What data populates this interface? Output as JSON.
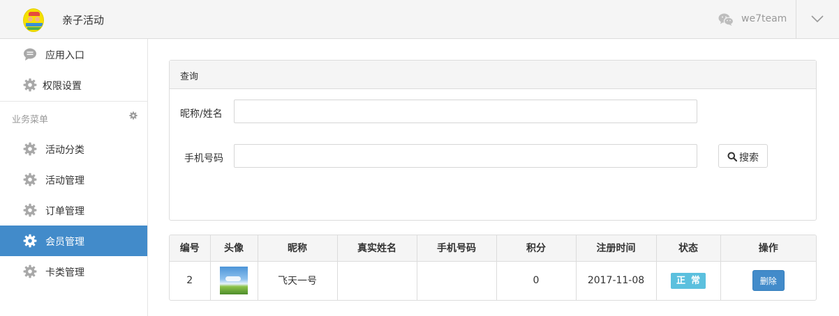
{
  "header": {
    "app_title": "亲子活动",
    "account_name": "we7team"
  },
  "sidebar": {
    "top_items": [
      {
        "label": "应用入口",
        "icon": "comment-icon"
      },
      {
        "label": "权限设置",
        "icon": "gear-icon"
      }
    ],
    "section_title": "业务菜单",
    "items": [
      {
        "label": "活动分类",
        "icon": "gear-icon"
      },
      {
        "label": "活动管理",
        "icon": "gear-icon"
      },
      {
        "label": "订单管理",
        "icon": "gear-icon"
      },
      {
        "label": "会员管理",
        "icon": "gear-icon",
        "active": true
      },
      {
        "label": "卡类管理",
        "icon": "gear-icon"
      }
    ]
  },
  "query": {
    "title": "查询",
    "name_label": "昵称/姓名",
    "name_value": "",
    "phone_label": "手机号码",
    "phone_value": "",
    "search_label": "搜索"
  },
  "table": {
    "headers": [
      "编号",
      "头像",
      "昵称",
      "真实姓名",
      "手机号码",
      "积分",
      "注册时间",
      "状态",
      "操作"
    ],
    "rows": [
      {
        "id": "2",
        "nickname": "飞天一号",
        "real_name": "",
        "phone": "",
        "points": "0",
        "registered": "2017-11-08",
        "status": "正常",
        "action": "删除"
      }
    ]
  },
  "colors": {
    "accent": "#428bca",
    "status_badge": "#5bc0de",
    "topbar_bg": "#f5f5f5"
  }
}
